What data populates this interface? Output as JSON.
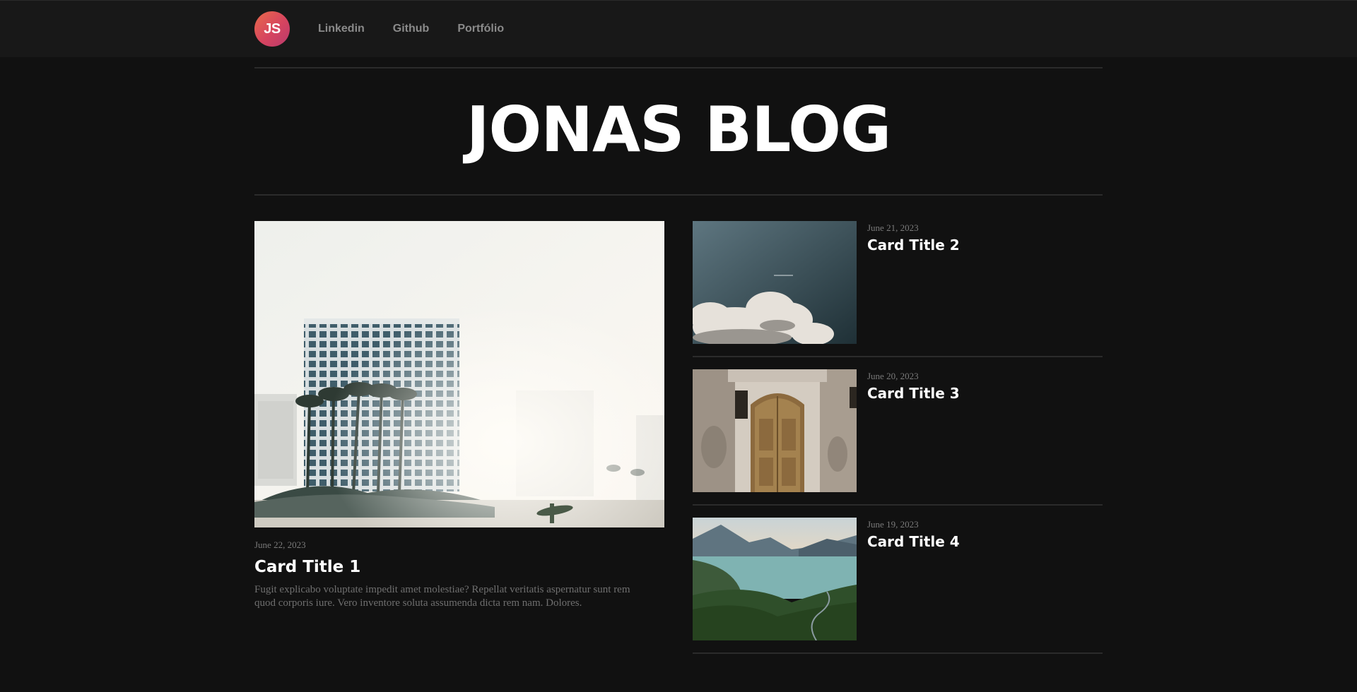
{
  "header": {
    "logo_text": "JS",
    "nav": [
      {
        "label": "Linkedin"
      },
      {
        "label": "Github"
      },
      {
        "label": "Portfólio"
      }
    ]
  },
  "hero": {
    "title": "JONAS BLOG"
  },
  "featured": {
    "date": "June 22, 2023",
    "title": "Card Title 1",
    "excerpt": "Fugit explicabo voluptate impedit amet molestiae? Repellat veritatis aspernatur sunt rem quod corporis iure. Vero inventore soluta assumenda dicta rem nam. Dolores."
  },
  "cards": [
    {
      "date": "June 21, 2023",
      "title": "Card Title 2"
    },
    {
      "date": "June 20, 2023",
      "title": "Card Title 3"
    },
    {
      "date": "June 19, 2023",
      "title": "Card Title 4"
    }
  ],
  "colors": {
    "background": "#111111",
    "topbar": "#181818",
    "divider": "#2b2b2b",
    "muted_text": "#7a7a7a",
    "logo_gradient_start": "#e86a4a",
    "logo_gradient_end": "#b93a6e"
  }
}
